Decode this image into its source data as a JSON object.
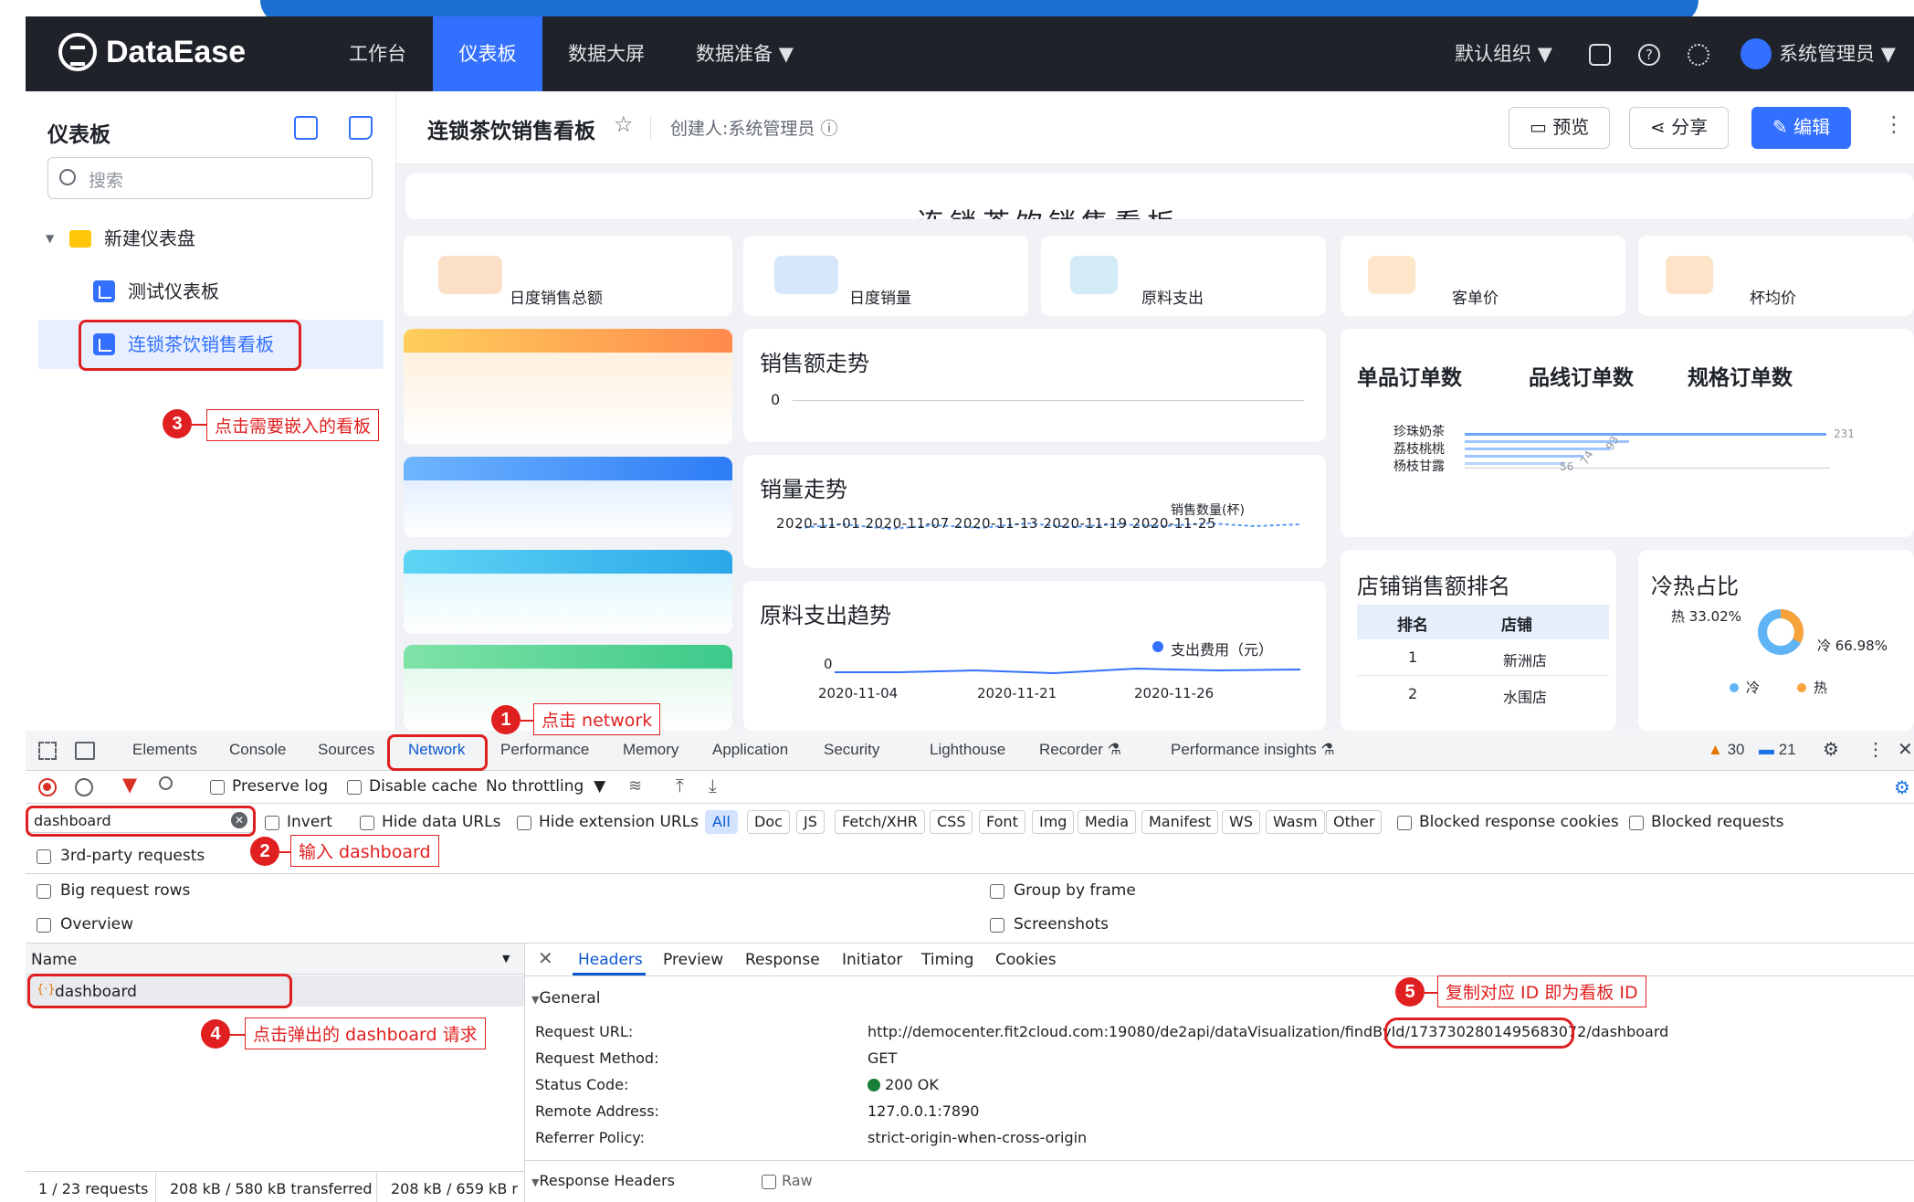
{
  "header": {
    "brand": "DataEase",
    "nav": [
      "工作台",
      "仪表板",
      "数据大屏",
      "数据准备"
    ],
    "org": "默认组织",
    "user": "系统管理员"
  },
  "sidebar": {
    "title": "仪表板",
    "search_placeholder": "搜索",
    "folder": "新建仪表盘",
    "items": [
      "测试仪表板",
      "连锁茶饮销售看板"
    ]
  },
  "board": {
    "title": "连锁茶饮销售看板",
    "creator": "创建人:系统管理员",
    "buttons": {
      "preview": "预览",
      "share": "分享",
      "edit": "编辑"
    },
    "kpis": [
      "日度销售总额",
      "日度销量",
      "原料支出",
      "客单价",
      "杯均价"
    ],
    "charts": {
      "sales_trend": {
        "title": "销售额走势",
        "zero": "0"
      },
      "volume_trend": {
        "title": "销量走势",
        "axis": "2020-11-01  2020-11-07  2020-11-13  2020-11-19  2020-11-25",
        "legend": "销售数量(杯)"
      },
      "material_trend": {
        "title": "原料支出趋势",
        "zero": "0",
        "legend": "支出费用（元）",
        "ticks": [
          "2020-11-04",
          "2020-11-21",
          "2020-11-26"
        ]
      },
      "orders": {
        "tabs": [
          "单品订单数",
          "品线订单数",
          "规格订单数"
        ],
        "products": [
          "珍珠奶茶",
          "荔枝桃桃",
          "杨枝甘露"
        ],
        "max": "231",
        "mids": [
          "56",
          "74",
          "93"
        ]
      },
      "store_rank": {
        "title": "店铺销售额排名",
        "headers": [
          "排名",
          "店铺"
        ],
        "rows": [
          [
            "1",
            "新洲店"
          ],
          [
            "2",
            "水围店"
          ]
        ]
      },
      "hot_cold": {
        "title": "冷热占比",
        "hot_label": "热 33.02%",
        "cold_label": "冷 66.98%",
        "legend": [
          "冷",
          "热"
        ]
      }
    }
  },
  "annotations": {
    "n1": "1",
    "t1": "点击 network",
    "n2": "2",
    "t2": "输入 dashboard",
    "n3": "3",
    "t3": "点击需要嵌入的看板",
    "n4": "4",
    "t4": "点击弹出的 dashboard 请求",
    "n5": "5",
    "t5": "复制对应 ID 即为看板 ID"
  },
  "devtools": {
    "tabs": [
      "Elements",
      "Console",
      "Sources",
      "Network",
      "Performance",
      "Memory",
      "Application",
      "Security",
      "Lighthouse",
      "Recorder",
      "Performance insights"
    ],
    "warnings": "30",
    "messages": "21",
    "preserve_log": "Preserve log",
    "disable_cache": "Disable cache",
    "throttling": "No throttling",
    "filter_value": "dashboard",
    "invert": "Invert",
    "hide_data": "Hide data URLs",
    "hide_ext": "Hide extension URLs",
    "types": [
      "All",
      "Doc",
      "JS",
      "Fetch/XHR",
      "CSS",
      "Font",
      "Img",
      "Media",
      "Manifest",
      "WS",
      "Wasm",
      "Other"
    ],
    "blocked_cookies": "Blocked response cookies",
    "blocked_requests": "Blocked requests",
    "third_party": "3rd-party requests",
    "big_rows": "Big request rows",
    "group_frame": "Group by frame",
    "overview": "Overview",
    "screenshots": "Screenshots",
    "name_col": "Name",
    "request_name": "dashboard",
    "detail_tabs": [
      "Headers",
      "Preview",
      "Response",
      "Initiator",
      "Timing",
      "Cookies"
    ],
    "general": "General",
    "fields": [
      {
        "k": "Request URL:",
        "v": "http://democenter.fit2cloud.com:19080/de2api/dataVisualization/findById/1737302801495683072/dashboard"
      },
      {
        "k": "Request Method:",
        "v": "GET"
      },
      {
        "k": "Status Code:",
        "v": "200 OK"
      },
      {
        "k": "Remote Address:",
        "v": "127.0.0.1:7890"
      },
      {
        "k": "Referrer Policy:",
        "v": "strict-origin-when-cross-origin"
      }
    ],
    "response_headers": "Response Headers",
    "raw": "Raw",
    "status_bar": [
      "1 / 23 requests",
      "208 kB / 580 kB transferred",
      "208 kB / 659 kB r"
    ]
  },
  "colors": {
    "brand_blue": "#3370ff",
    "dark_header": "#1f2329",
    "annotation_red": "#e02020"
  }
}
